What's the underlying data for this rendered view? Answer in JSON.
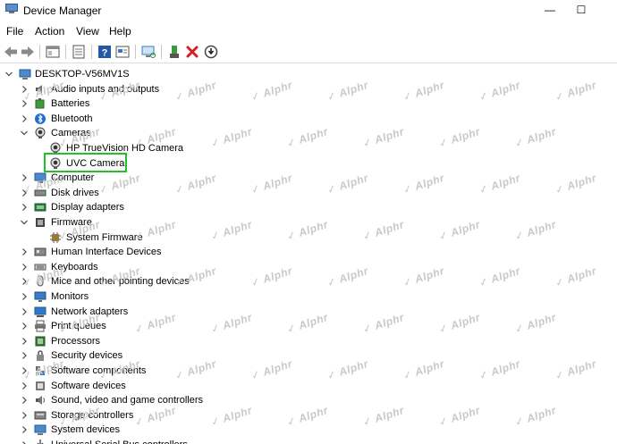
{
  "window": {
    "title": "Device Manager"
  },
  "menu": [
    "File",
    "Action",
    "View",
    "Help"
  ],
  "tree": {
    "root": "DESKTOP-V56MV1S",
    "items": [
      {
        "label": "Audio inputs and outputs",
        "icon": "speaker-icon",
        "expanded": false,
        "children": []
      },
      {
        "label": "Batteries",
        "icon": "battery-icon",
        "expanded": false,
        "children": []
      },
      {
        "label": "Bluetooth",
        "icon": "bluetooth-icon",
        "expanded": false,
        "children": []
      },
      {
        "label": "Cameras",
        "icon": "camera-icon",
        "expanded": true,
        "children": [
          "HP TrueVision HD Camera",
          "UVC Camera"
        ]
      },
      {
        "label": "Computer",
        "icon": "computer-icon",
        "expanded": false,
        "children": []
      },
      {
        "label": "Disk drives",
        "icon": "disk-icon",
        "expanded": false,
        "children": []
      },
      {
        "label": "Display adapters",
        "icon": "display-icon",
        "expanded": false,
        "children": []
      },
      {
        "label": "Firmware",
        "icon": "firmware-icon",
        "expanded": true,
        "children": [
          "System Firmware"
        ]
      },
      {
        "label": "Human Interface Devices",
        "icon": "hid-icon",
        "expanded": false,
        "children": []
      },
      {
        "label": "Keyboards",
        "icon": "keyboard-icon",
        "expanded": false,
        "children": []
      },
      {
        "label": "Mice and other pointing devices",
        "icon": "mouse-icon",
        "expanded": false,
        "children": []
      },
      {
        "label": "Monitors",
        "icon": "monitor-icon",
        "expanded": false,
        "children": []
      },
      {
        "label": "Network adapters",
        "icon": "network-icon",
        "expanded": false,
        "children": []
      },
      {
        "label": "Print queues",
        "icon": "printer-icon",
        "expanded": false,
        "children": []
      },
      {
        "label": "Processors",
        "icon": "processor-icon",
        "expanded": false,
        "children": []
      },
      {
        "label": "Security devices",
        "icon": "security-icon",
        "expanded": false,
        "children": []
      },
      {
        "label": "Software components",
        "icon": "software-component-icon",
        "expanded": false,
        "children": []
      },
      {
        "label": "Software devices",
        "icon": "software-device-icon",
        "expanded": false,
        "children": []
      },
      {
        "label": "Sound, video and game controllers",
        "icon": "sound-icon",
        "expanded": false,
        "children": []
      },
      {
        "label": "Storage controllers",
        "icon": "storage-icon",
        "expanded": false,
        "children": []
      },
      {
        "label": "System devices",
        "icon": "system-icon",
        "expanded": false,
        "children": []
      },
      {
        "label": "Universal Serial Bus controllers",
        "icon": "usb-icon",
        "expanded": false,
        "children": []
      }
    ],
    "highlighted": "UVC Camera"
  },
  "watermark": "Alphr",
  "colors": {
    "highlight": "#22c02a",
    "remove": "#d32020"
  }
}
